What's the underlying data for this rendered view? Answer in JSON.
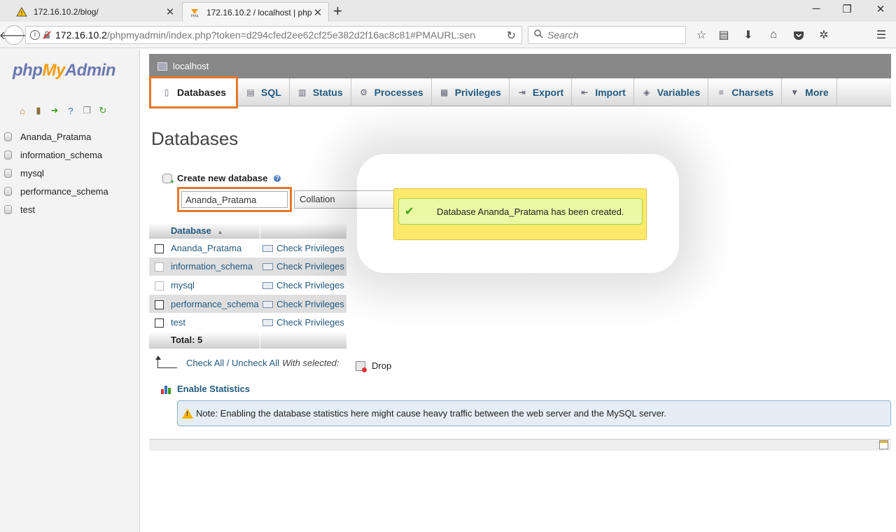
{
  "browser": {
    "tabs": [
      {
        "title": "172.16.10.2/blog/",
        "active": false
      },
      {
        "title": "172.16.10.2 / localhost | php­",
        "active": true
      }
    ],
    "url_host": "172.16.10.2",
    "url_path": "/phpmyadmin/index.php?token=d294cfed2ee62cf25e382d2f16ac8c81#PMAURL:serve",
    "search_placeholder": "Search"
  },
  "left_panel": {
    "logo": {
      "php": "php",
      "my": "My",
      "admin": "Admin"
    },
    "databases": [
      "Ananda_Pratama",
      "information_schema",
      "mysql",
      "performance_schema",
      "test"
    ]
  },
  "server_bar": {
    "label": "localhost"
  },
  "top_menu": [
    {
      "label": "Databases",
      "icon": "database-icon",
      "active": true
    },
    {
      "label": "SQL",
      "icon": "sql-icon"
    },
    {
      "label": "Status",
      "icon": "status-icon"
    },
    {
      "label": "Processes",
      "icon": "processes-icon"
    },
    {
      "label": "Privileges",
      "icon": "privileges-icon"
    },
    {
      "label": "Export",
      "icon": "export-icon"
    },
    {
      "label": "Import",
      "icon": "import-icon"
    },
    {
      "label": "Variables",
      "icon": "variables-icon"
    },
    {
      "label": "Charsets",
      "icon": "charsets-icon"
    },
    {
      "label": "More",
      "icon": "more-arrow-icon"
    }
  ],
  "page_title": "Databases",
  "create": {
    "label": "Create new database",
    "db_name_value": "Ananda_Pratama",
    "collation_label": "Collation"
  },
  "table": {
    "header": "Database",
    "rows": [
      {
        "name": "Ananda_Pratama",
        "action": "Check Privileges"
      },
      {
        "name": "information_schema",
        "action": "Check Privileges"
      },
      {
        "name": "mysql",
        "action": "Check Privileges"
      },
      {
        "name": "performance_schema",
        "action": "Check Privileges"
      },
      {
        "name": "test",
        "action": "Check Privileges"
      }
    ],
    "total": "Total: 5"
  },
  "bulk": {
    "check_all": "Check All",
    "separator": " / ",
    "uncheck_all": "Uncheck All",
    "with_selected": "With selected:",
    "drop": "Drop"
  },
  "stats": {
    "enable_label": "Enable Statistics",
    "note": "Note: Enabling the database statistics here might cause heavy traffic between the web server and the MySQL server."
  },
  "popup": {
    "message": "Database Ananda_Pratama has been created."
  },
  "colors": {
    "accent_orange": "#e6782b",
    "link_blue": "#235a81",
    "success_green": "#3b9e19",
    "popup_yellow": "#ffe96b"
  }
}
